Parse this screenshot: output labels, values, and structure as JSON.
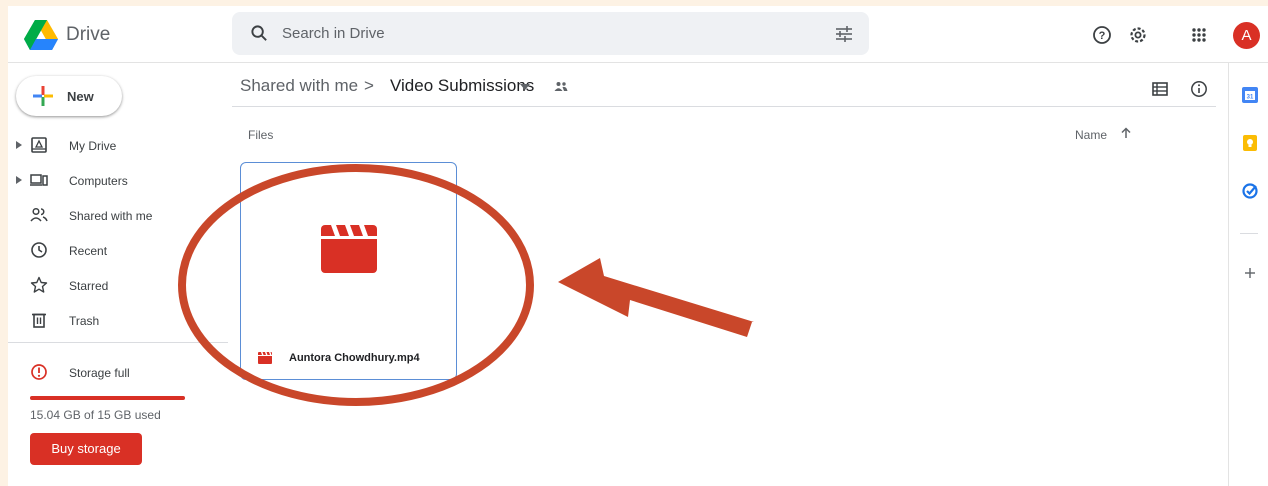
{
  "app": {
    "name": "Drive"
  },
  "search": {
    "placeholder": "Search in Drive"
  },
  "avatar": {
    "initial": "A",
    "color": "#d93025"
  },
  "sidebar": {
    "new_label": "New",
    "items": [
      {
        "label": "My Drive",
        "icon": "my-drive-icon",
        "expandable": true
      },
      {
        "label": "Computers",
        "icon": "computers-icon",
        "expandable": true
      },
      {
        "label": "Shared with me",
        "icon": "people-icon",
        "expandable": false
      },
      {
        "label": "Recent",
        "icon": "clock-icon",
        "expandable": false
      },
      {
        "label": "Starred",
        "icon": "star-icon",
        "expandable": false
      },
      {
        "label": "Trash",
        "icon": "trash-icon",
        "expandable": false
      }
    ],
    "storage": {
      "status": "Storage full",
      "used_text": "15.04 GB of 15 GB used",
      "used_fraction": 1.0,
      "buy_label": "Buy storage"
    }
  },
  "breadcrumb": {
    "parent": "Shared with me",
    "separator": ">",
    "current": "Video Submissions"
  },
  "content": {
    "section_label": "Files",
    "sort_label": "Name",
    "sort_direction": "ascending",
    "files": [
      {
        "name": "Auntora Chowdhury.mp4",
        "type": "video",
        "icon": "video-clapper-icon"
      }
    ]
  },
  "colors": {
    "accent_red": "#d93025",
    "annotation": "#c9472a",
    "selection_border": "#5b8ed6"
  }
}
